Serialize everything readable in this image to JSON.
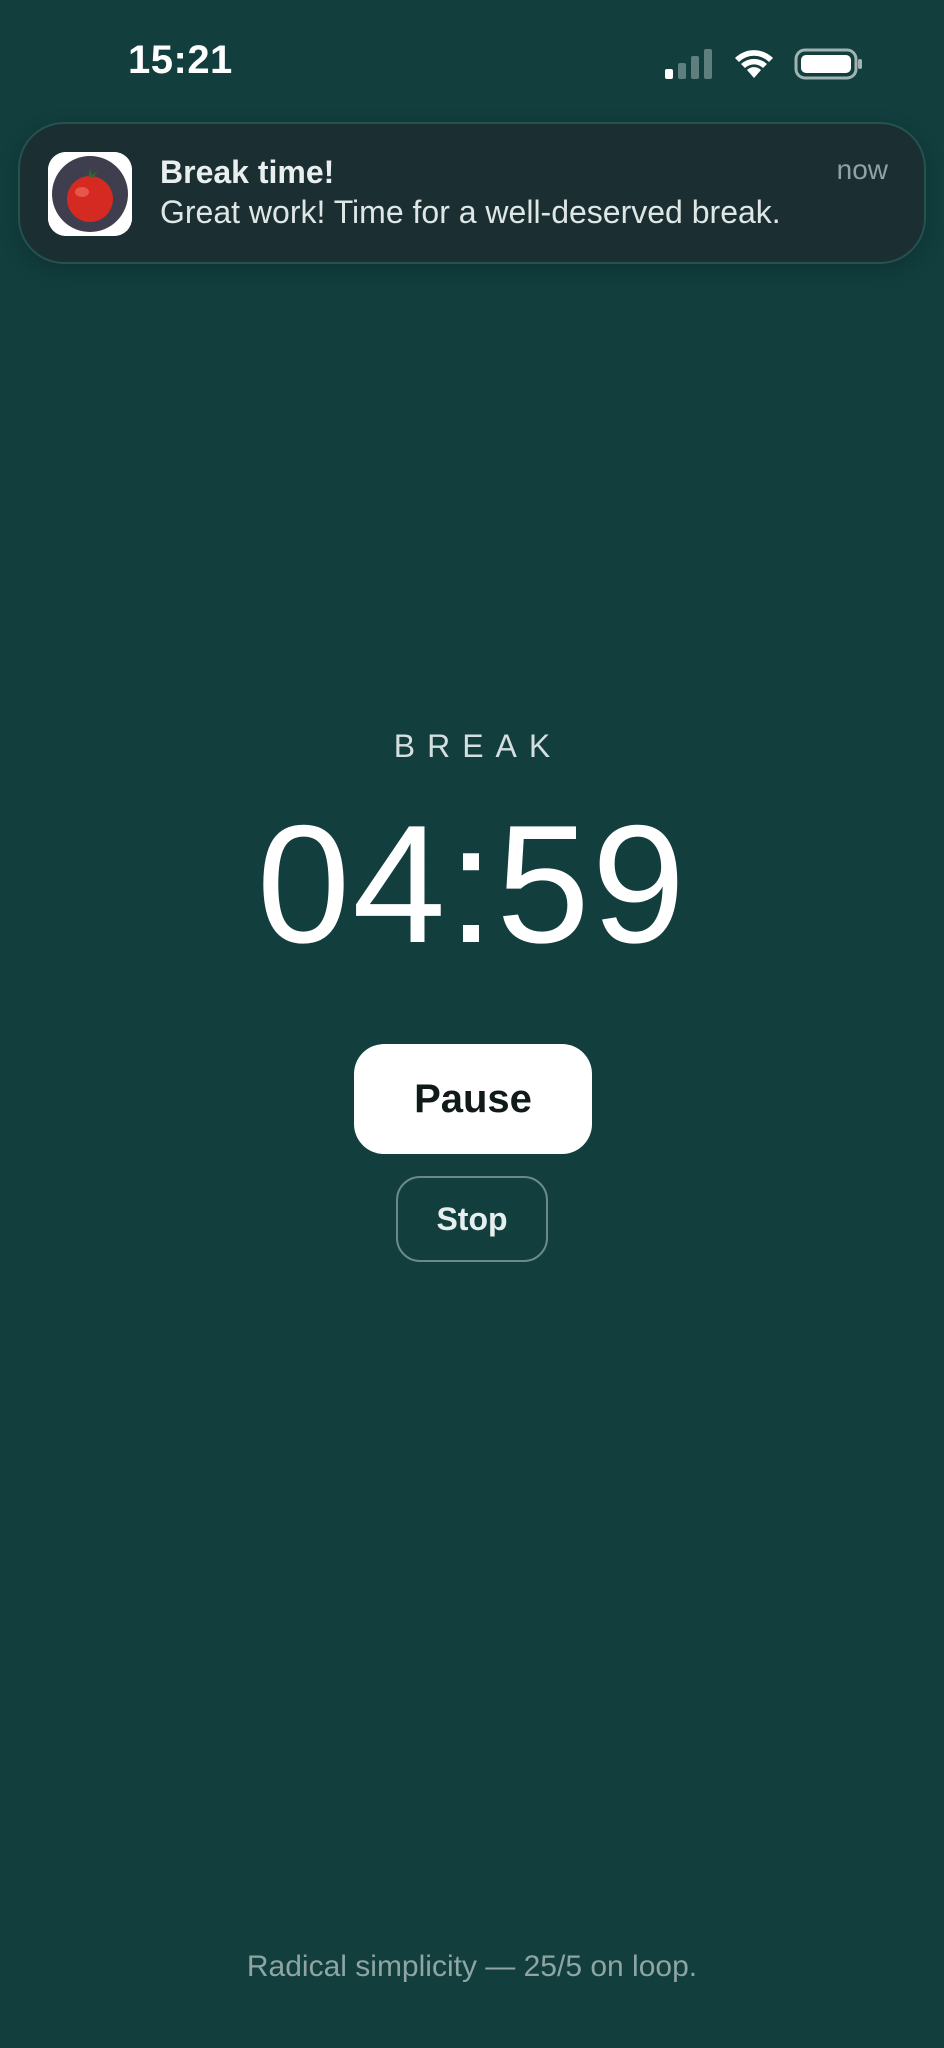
{
  "status_bar": {
    "time": "15:21",
    "icons": [
      "cellular-signal-icon",
      "wifi-icon",
      "battery-icon"
    ]
  },
  "notification": {
    "app_icon": "tomato-icon",
    "title": "Break time!",
    "body": "Great work! Time for a well-deserved break.",
    "time": "now"
  },
  "timer": {
    "mode_label": "BREAK",
    "display": "04:59"
  },
  "controls": {
    "pause_label": "Pause",
    "stop_label": "Stop"
  },
  "footer": {
    "tagline": "Radical simplicity — 25/5 on loop."
  },
  "colors": {
    "background": "#123e3e",
    "notification_background": "#1b2f32",
    "primary_button": "#ffffff",
    "tomato_red": "#d42a22"
  }
}
